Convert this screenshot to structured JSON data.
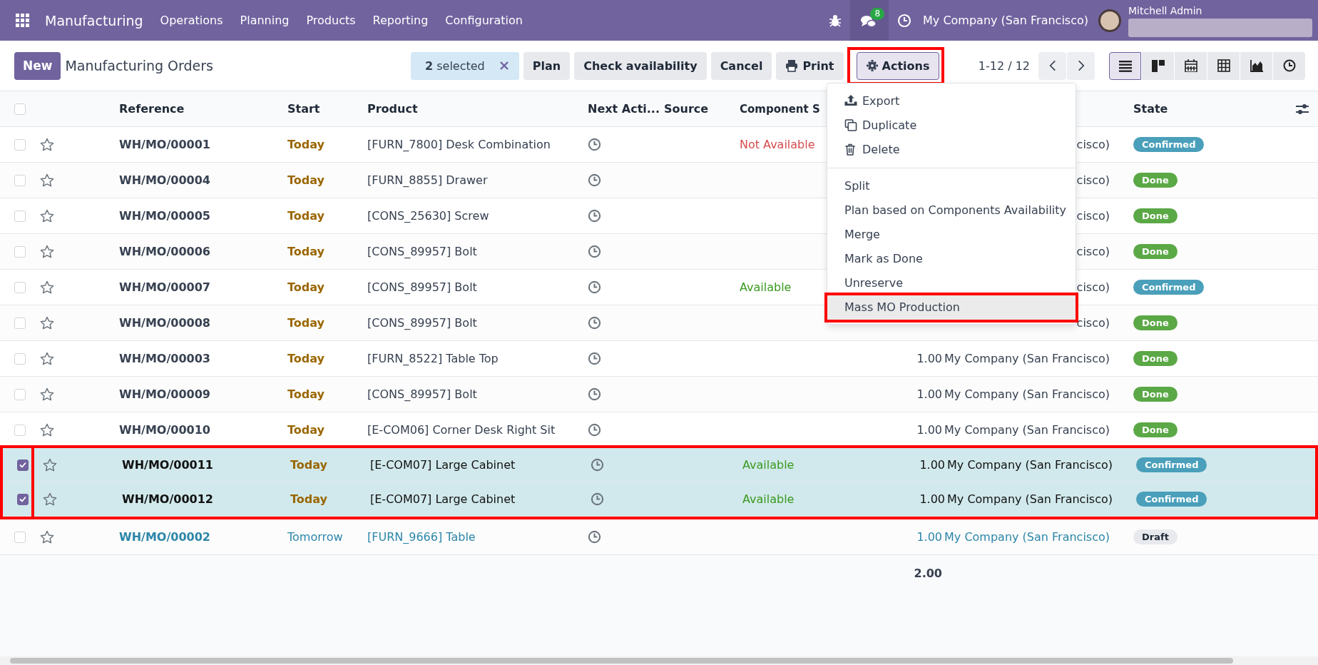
{
  "navbar": {
    "app_name": "Manufacturing",
    "menu": [
      "Operations",
      "Planning",
      "Products",
      "Reporting",
      "Configuration"
    ],
    "chat_count": "8",
    "company": "My Company (San Francisco)",
    "user": "Mitchell Admin"
  },
  "control_bar": {
    "new_button": "New",
    "title": "Manufacturing Orders",
    "selection": "**2** selected",
    "buttons": [
      "Plan",
      "Check availability",
      "Cancel"
    ],
    "print": "Print",
    "actions": {
      "label": "Actions",
      "highlighted": true
    },
    "pager": "1-12 / 12",
    "views": [
      {
        "kind": "list",
        "selected": true
      },
      {
        "kind": "kanban",
        "selected": false
      },
      {
        "kind": "calendar",
        "selected": false
      },
      {
        "kind": "pivot",
        "selected": false
      },
      {
        "kind": "graph",
        "selected": false
      },
      {
        "kind": "activity",
        "selected": false
      }
    ]
  },
  "actions_menu": {
    "groups": [
      [
        {
          "kind": "export",
          "label": "Export",
          "highlighted": false
        },
        {
          "kind": "duplicate",
          "label": "Duplicate",
          "highlighted": false
        },
        {
          "kind": "delete",
          "label": "Delete",
          "highlighted": false
        }
      ],
      [
        {
          "kind": "plain",
          "label": "Split",
          "highlighted": false
        },
        {
          "kind": "plain",
          "label": "Plan based on Components Availability",
          "highlighted": false
        },
        {
          "kind": "plain",
          "label": "Merge",
          "highlighted": false
        },
        {
          "kind": "plain",
          "label": "Mark as Done",
          "highlighted": false
        },
        {
          "kind": "plain",
          "label": "Unreserve",
          "highlighted": false
        },
        {
          "kind": "plain",
          "label": "Mass MO Production",
          "highlighted": true
        }
      ]
    ]
  },
  "table": {
    "all_selected": false,
    "columns": [
      "Reference",
      "Start",
      "Product",
      "Next Acti...",
      "Source",
      "Component S"
    ],
    "state_column": "State",
    "rows": [
      {
        "reference": "WH/MO/00001",
        "start": "Today",
        "product": "[FURN_7800] Desk Combination",
        "component_status": {
          "kind": "not_available",
          "text": "Not Available"
        },
        "company": "cisco)",
        "state": {
          "kind": "confirmed",
          "text": "Confirmed"
        },
        "selected": false
      },
      {
        "reference": "WH/MO/00004",
        "start": "Today",
        "product": "[FURN_8855] Drawer",
        "company": "cisco)",
        "state": {
          "kind": "done",
          "text": "Done"
        },
        "selected": false
      },
      {
        "reference": "WH/MO/00005",
        "start": "Today",
        "product": "[CONS_25630] Screw",
        "company": "cisco)",
        "state": {
          "kind": "done",
          "text": "Done"
        },
        "selected": false
      },
      {
        "reference": "WH/MO/00006",
        "start": "Today",
        "product": "[CONS_89957] Bolt",
        "company": "cisco)",
        "state": {
          "kind": "done",
          "text": "Done"
        },
        "selected": false
      },
      {
        "reference": "WH/MO/00007",
        "start": "Today",
        "product": "[CONS_89957] Bolt",
        "component_status": {
          "kind": "available",
          "text": "Available"
        },
        "company": "cisco)",
        "state": {
          "kind": "confirmed",
          "text": "Confirmed"
        },
        "selected": false
      },
      {
        "reference": "WH/MO/00008",
        "start": "Today",
        "product": "[CONS_89957] Bolt",
        "company": "cisco)",
        "state": {
          "kind": "done",
          "text": "Done"
        },
        "selected": false
      },
      {
        "reference": "WH/MO/00003",
        "start": "Today",
        "product": "[FURN_8522] Table Top",
        "quantity": "1.00",
        "company": "My Company (San Francisco)",
        "state": {
          "kind": "done",
          "text": "Done"
        },
        "selected": false
      },
      {
        "reference": "WH/MO/00009",
        "start": "Today",
        "product": "[CONS_89957] Bolt",
        "quantity": "1.00",
        "company": "My Company (San Francisco)",
        "state": {
          "kind": "done",
          "text": "Done"
        },
        "selected": false
      },
      {
        "reference": "WH/MO/00010",
        "start": "Today",
        "product": "[E-COM06] Corner Desk Right Sit",
        "quantity": "1.00",
        "company": "My Company (San Francisco)",
        "state": {
          "kind": "done",
          "text": "Done"
        },
        "selected": false
      },
      {
        "reference": "WH/MO/00011",
        "start": "Today",
        "product": "[E-COM07] Large Cabinet",
        "component_status": {
          "kind": "available",
          "text": "Available"
        },
        "quantity": "1.00",
        "company": "My Company (San Francisco)",
        "state": {
          "kind": "confirmed",
          "text": "Confirmed"
        },
        "selected": true
      },
      {
        "reference": "WH/MO/00012",
        "start": "Today",
        "product": "[E-COM07] Large Cabinet",
        "component_status": {
          "kind": "available",
          "text": "Available"
        },
        "quantity": "1.00",
        "company": "My Company (San Francisco)",
        "state": {
          "kind": "confirmed",
          "text": "Confirmed"
        },
        "selected": true
      },
      {
        "reference": "WH/MO/00002",
        "start": "Tomorrow",
        "product": "[FURN_9666] Table",
        "quantity": "1.00",
        "company": "My Company (San Francisco)",
        "state": {
          "kind": "draft",
          "text": "Draft"
        },
        "selected": false
      }
    ],
    "total_quantity": "2.00"
  }
}
